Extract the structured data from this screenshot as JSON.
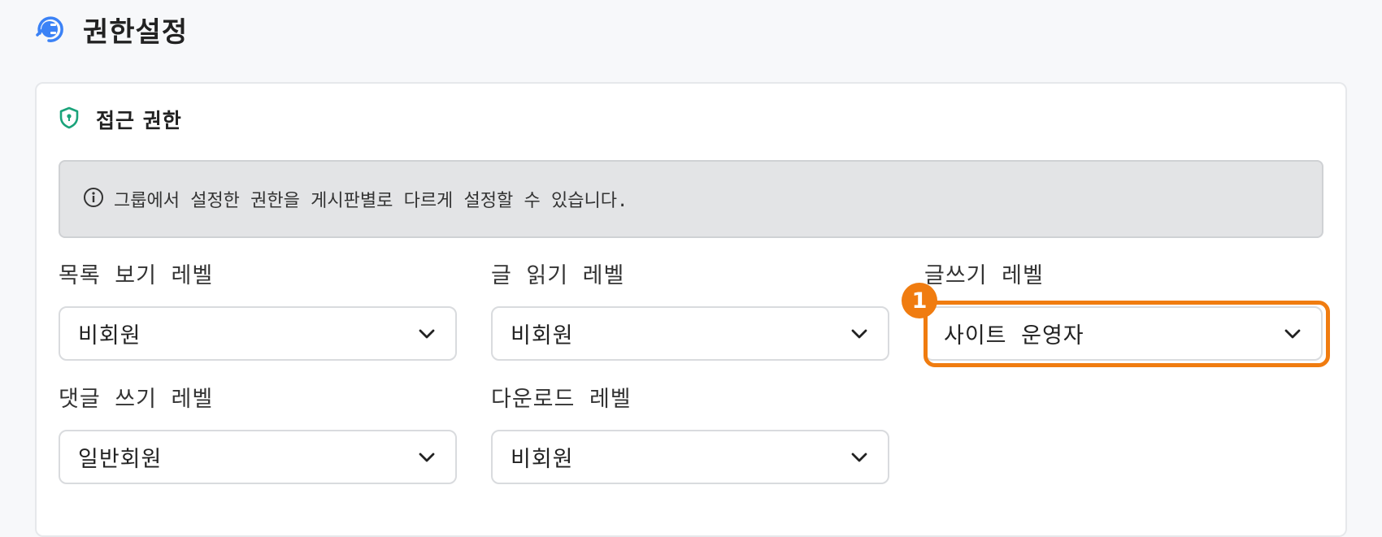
{
  "page": {
    "title": "권한설정",
    "icon": "plug-icon"
  },
  "section": {
    "title": "접근 권한",
    "icon": "shield-lock-icon"
  },
  "notice": {
    "icon": "info-icon",
    "text": "그룹에서 설정한 권한을 게시판별로 다르게 설정할 수 있습니다."
  },
  "fields": {
    "list_view": {
      "label": "목록 보기 레벨",
      "value": "비회원"
    },
    "read": {
      "label": "글 읽기 레벨",
      "value": "비회원"
    },
    "write": {
      "label": "글쓰기 레벨",
      "value": "사이트 운영자"
    },
    "comment": {
      "label": "댓글 쓰기 레벨",
      "value": "일반회원"
    },
    "download": {
      "label": "다운로드 레벨",
      "value": "비회원"
    }
  },
  "annotation": {
    "badge_number": "1",
    "color": "#f07c10"
  },
  "colors": {
    "accent_blue": "#3b82f6",
    "shield_green": "#1aa37a"
  }
}
